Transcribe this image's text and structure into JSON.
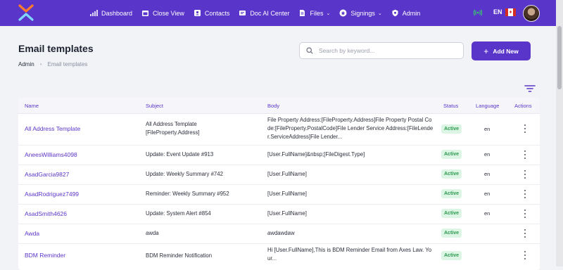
{
  "nav": {
    "items": [
      {
        "label": "Dashboard",
        "icon": "chart-icon"
      },
      {
        "label": "Close View",
        "icon": "calendar-icon"
      },
      {
        "label": "Contacts",
        "icon": "contact-card-icon"
      },
      {
        "label": "Doc AI Center",
        "icon": "document-icon"
      },
      {
        "label": "Files",
        "icon": "file-icon",
        "dropdown": true
      },
      {
        "label": "Signings",
        "icon": "badge-star-icon",
        "dropdown": true
      },
      {
        "label": "Admin",
        "icon": "shield-icon"
      }
    ],
    "language": "EN",
    "flag": "canada-flag-icon"
  },
  "header": {
    "title": "Email templates",
    "breadcrumb": [
      "Admin",
      "Email templates"
    ],
    "search_placeholder": "Search by keyword...",
    "add_label": "Add New"
  },
  "table": {
    "columns": [
      "Name",
      "Subject",
      "Body",
      "Status",
      "Language",
      "Actions"
    ],
    "rows": [
      {
        "name": "All Address Template",
        "subject": "All Address Template [FileProperty.Address]",
        "body": "File Property Address:[FileProperty.Address]File Property Postal Code:[FileProperty.PostalCode]File Lender Service Address:[FileLender.ServiceAddress]File Lender...",
        "status": "Active",
        "language": "en"
      },
      {
        "name": "AneesWilliams4098",
        "subject": "Update: Event Update #913",
        "body": "[User.FullName]&nbsp;[FileDigest.Type]",
        "status": "Active",
        "language": "en"
      },
      {
        "name": "AsadGarcia9827",
        "subject": "Update: Weekly Summary #742",
        "body": "[User.FullName]",
        "status": "Active",
        "language": "en"
      },
      {
        "name": "AsadRodriguez7499",
        "subject": "Reminder: Weekly Summary #952",
        "body": "[User.FullName]",
        "status": "Active",
        "language": "en"
      },
      {
        "name": "AsadSmith4626",
        "subject": "Update: System Alert #854",
        "body": "[User.FullName]",
        "status": "Active",
        "language": "en"
      },
      {
        "name": "Awda",
        "subject": "awda",
        "body": "awdawdaw",
        "status": "Active",
        "language": ""
      },
      {
        "name": "BDM Reminder",
        "subject": "BDM Reminder Notification",
        "body": "Hi [User.FullName],This is BDM Reminder Email from Axes Law. Your...",
        "status": "Active",
        "language": ""
      }
    ]
  },
  "colors": {
    "primary": "#5a35c9",
    "active_bg": "#ddf5e4",
    "active_text": "#2a9a4e"
  }
}
